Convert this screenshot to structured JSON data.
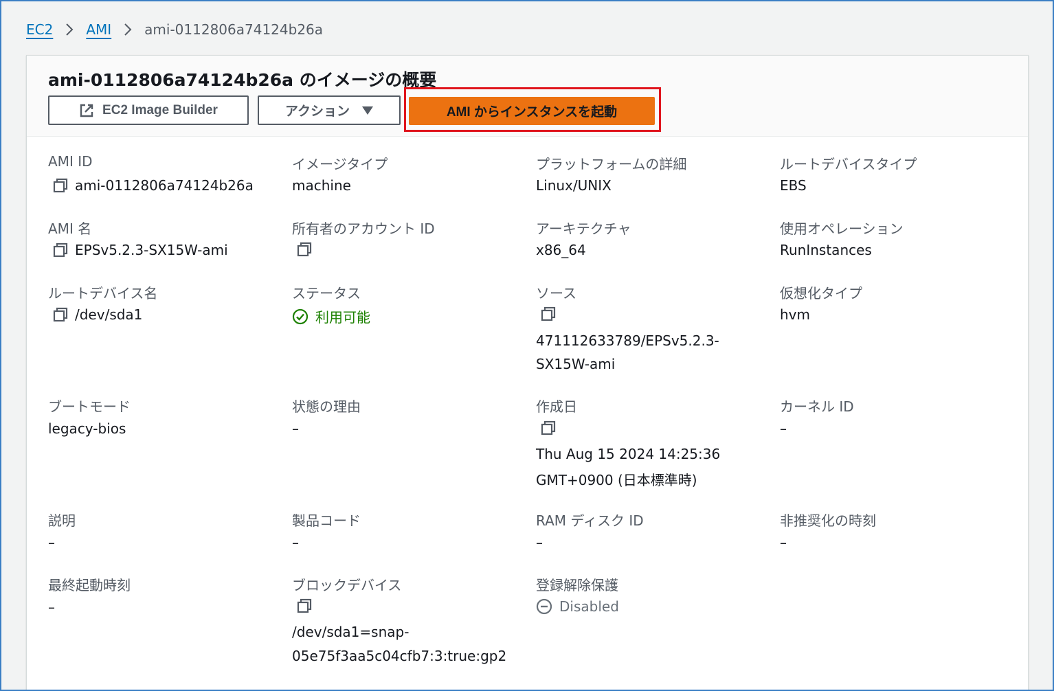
{
  "breadcrumb": {
    "items": [
      "EC2",
      "AMI"
    ],
    "current": "ami-0112806a74124b26a"
  },
  "page": {
    "title": "ami-0112806a74124b26a のイメージの概要",
    "buttons": {
      "builder": "EC2 Image Builder",
      "actions": "アクション",
      "launch": "AMI からインスタンスを起動"
    }
  },
  "details": {
    "ami_id": {
      "label": "AMI ID",
      "value": "ami-0112806a74124b26a"
    },
    "image_type": {
      "label": "イメージタイプ",
      "value": "machine"
    },
    "platform": {
      "label": "プラットフォームの詳細",
      "value": "Linux/UNIX"
    },
    "root_device_type": {
      "label": "ルートデバイスタイプ",
      "value": "EBS"
    },
    "ami_name": {
      "label": "AMI 名",
      "value": "EPSv5.2.3-SX15W-ami"
    },
    "owner_account": {
      "label": "所有者のアカウント ID",
      "value": ""
    },
    "architecture": {
      "label": "アーキテクチャ",
      "value": "x86_64"
    },
    "usage_operation": {
      "label": "使用オペレーション",
      "value": "RunInstances"
    },
    "root_device_name": {
      "label": "ルートデバイス名",
      "value": "/dev/sda1"
    },
    "status": {
      "label": "ステータス",
      "value": "利用可能"
    },
    "source": {
      "label": "ソース",
      "line1": "471112633789/EPSv5.2.3-",
      "line2": "SX15W-ami"
    },
    "virtualization": {
      "label": "仮想化タイプ",
      "value": "hvm"
    },
    "boot_mode": {
      "label": "ブートモード",
      "value": "legacy-bios"
    },
    "state_reason": {
      "label": "状態の理由",
      "value": "–"
    },
    "created": {
      "label": "作成日",
      "line1": "Thu Aug 15 2024 14:25:36",
      "line2": "GMT+0900 (日本標準時)"
    },
    "kernel_id": {
      "label": "カーネル ID",
      "value": "–"
    },
    "description": {
      "label": "説明",
      "value": "–"
    },
    "product_code": {
      "label": "製品コード",
      "value": "–"
    },
    "ramdisk_id": {
      "label": "RAM ディスク ID",
      "value": "–"
    },
    "deprecation": {
      "label": "非推奨化の時刻",
      "value": "–"
    },
    "last_launch": {
      "label": "最終起動時刻",
      "value": "–"
    },
    "block_devices": {
      "label": "ブロックデバイス",
      "line1": "/dev/sda1=snap-",
      "line2": "05e75f3aa5c04cfb7:3:true:gp2"
    },
    "deregistration_protection": {
      "label": "登録解除保護",
      "value": "Disabled"
    }
  },
  "colors": {
    "link": "#0073bb",
    "primary_button": "#ec7211",
    "highlight": "#e0151d",
    "status_available": "#1d8102",
    "frame": "#3a7ec4"
  }
}
